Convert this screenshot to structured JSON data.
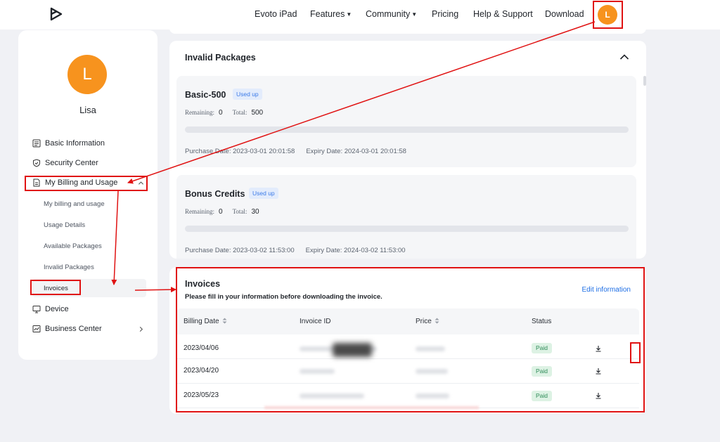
{
  "topnav": {
    "items": [
      {
        "label": "Evoto iPad"
      },
      {
        "label": "Features",
        "caret": "▼"
      },
      {
        "label": "Community",
        "caret": "▼"
      },
      {
        "label": "Pricing"
      },
      {
        "label": "Help & Support"
      },
      {
        "label": "Download"
      }
    ],
    "avatar_letter": "L"
  },
  "sidebar": {
    "avatar_letter": "L",
    "username": "Lisa",
    "items": [
      {
        "label": "Basic Information",
        "icon": "form-icon"
      },
      {
        "label": "Security Center",
        "icon": "shield-icon"
      },
      {
        "label": "My Billing and Usage",
        "icon": "document-icon"
      }
    ],
    "sub_items": [
      {
        "label": "My billing and usage"
      },
      {
        "label": "Usage Details"
      },
      {
        "label": "Available Packages"
      },
      {
        "label": "Invalid Packages"
      },
      {
        "label": "Invoices"
      }
    ],
    "bottom_items": [
      {
        "label": "Device",
        "icon": "monitor-icon"
      },
      {
        "label": "Business Center",
        "icon": "chart-icon"
      }
    ]
  },
  "invalid_packages": {
    "title": "Invalid Packages",
    "packages": [
      {
        "name": "Basic-500",
        "badge": "Used up",
        "remaining_label": "Remaining:",
        "remaining": "0",
        "total_label": "Total:",
        "total": "500",
        "purchase_date": "Purchase Date: 2023-03-01 20:01:58",
        "expiry_date": "Expiry Date: 2024-03-01 20:01:58"
      },
      {
        "name": "Bonus Credits",
        "badge": "Used up",
        "remaining_label": "Remaining:",
        "remaining": "0",
        "total_label": "Total:",
        "total": "30",
        "purchase_date": "Purchase Date: 2023-03-02 11:53:00",
        "expiry_date": "Expiry Date: 2024-03-02 11:53:00"
      }
    ]
  },
  "invoices": {
    "title": "Invoices",
    "note": "Please fill in your information before downloading the invoice.",
    "edit_link": "Edit information",
    "columns": [
      "Billing Date",
      "Invoice ID",
      "Price",
      "Status"
    ],
    "rows": [
      {
        "date": "2023/04/06",
        "status": "Paid"
      },
      {
        "date": "2023/04/20",
        "status": "Paid"
      },
      {
        "date": "2023/05/23",
        "status": "Paid"
      }
    ]
  },
  "colors": {
    "accent_orange": "#f7931e",
    "link_blue": "#1f6fe5",
    "annotation_red": "#e01212",
    "paid_green": "#2e8b57"
  }
}
